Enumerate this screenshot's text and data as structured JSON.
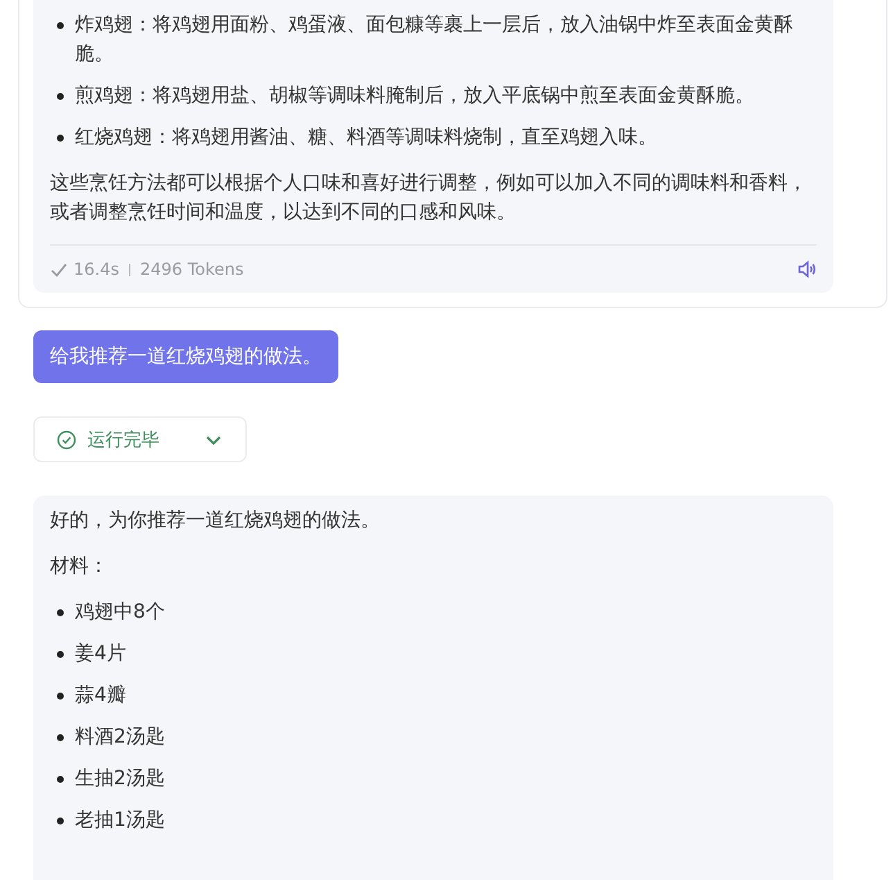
{
  "messages": [
    {
      "kind": "assistant",
      "framed": true,
      "blocks": [
        {
          "kind": "list",
          "items": [
            "炸鸡翅：将鸡翅用面粉、鸡蛋液、面包糠等裹上一层后，放入油锅中炸至表面金黄酥脆。",
            "煎鸡翅：将鸡翅用盐、胡椒等调味料腌制后，放入平底锅中煎至表面金黄酥脆。",
            "红烧鸡翅：将鸡翅用酱油、糖、料酒等调味料烧制，直至鸡翅入味。"
          ]
        },
        {
          "kind": "paragraph",
          "text": "这些烹饪方法都可以根据个人口味和喜好进行调整，例如可以加入不同的调味料和香料，或者调整烹饪时间和温度，以达到不同的口感和风味。"
        }
      ],
      "footer": {
        "duration": "16.4s",
        "tokens": "2496 Tokens"
      }
    },
    {
      "kind": "user",
      "text": "给我推荐一道红烧鸡翅的做法。"
    },
    {
      "kind": "status",
      "label": "运行完毕",
      "expanded": false
    },
    {
      "kind": "assistant",
      "framed": false,
      "blocks": [
        {
          "kind": "paragraph",
          "text": "好的，为你推荐一道红烧鸡翅的做法。"
        },
        {
          "kind": "paragraph",
          "text": "材料："
        },
        {
          "kind": "list",
          "items": [
            "鸡翅中8个",
            "姜4片",
            "蒜4瓣",
            "料酒2汤匙",
            "生抽2汤匙",
            "老抽1汤匙"
          ]
        }
      ]
    }
  ]
}
